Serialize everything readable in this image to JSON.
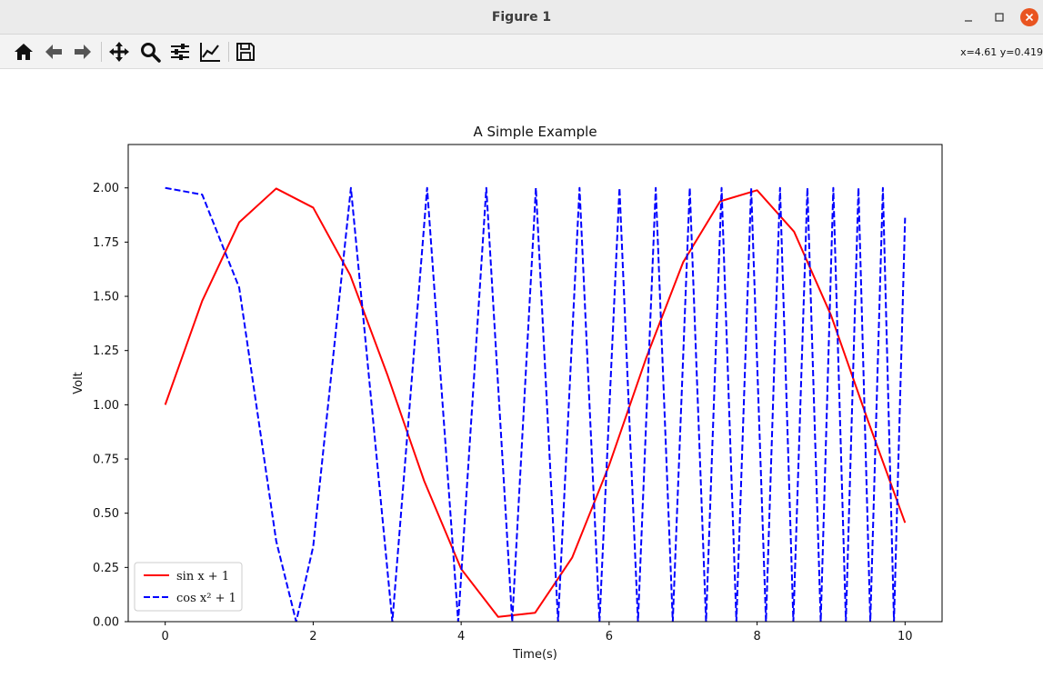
{
  "window": {
    "title": "Figure 1"
  },
  "toolbar": {
    "tools": [
      "home-icon",
      "back-arrow-icon",
      "forward-arrow-icon",
      "move-icon",
      "zoom-icon",
      "sliders-icon",
      "line-chart-icon",
      "save-icon"
    ],
    "coords": "x=4.61 y=0.419"
  },
  "chart_data": {
    "type": "line",
    "title": "A Simple Example",
    "xlabel": "Time(s)",
    "ylabel": "Volt",
    "xlim": [
      -0.5,
      10.5
    ],
    "ylim": [
      0.0,
      2.2
    ],
    "x_ticks": [
      "0",
      "2",
      "4",
      "6",
      "8",
      "10"
    ],
    "y_ticks": [
      "0.00",
      "0.25",
      "0.50",
      "0.75",
      "1.00",
      "1.25",
      "1.50",
      "1.75",
      "2.00"
    ],
    "grid": false,
    "legend_position": "lower-left",
    "series": [
      {
        "name": "sin x + 1",
        "color": "#ff0000",
        "style": "solid",
        "x": [
          0.0,
          0.5,
          1.0,
          1.5,
          2.0,
          2.5,
          3.0,
          3.5,
          4.0,
          4.5,
          5.0,
          5.5,
          6.0,
          6.5,
          7.0,
          7.5,
          8.0,
          8.5,
          9.0,
          9.5,
          10.0
        ],
        "y": [
          1.0,
          1.479,
          1.841,
          1.997,
          1.909,
          1.598,
          1.141,
          0.649,
          0.243,
          0.022,
          0.041,
          0.295,
          0.721,
          1.215,
          1.657,
          1.938,
          1.989,
          1.798,
          1.412,
          0.925,
          0.456
        ]
      },
      {
        "name": "cos x² + 1",
        "color": "#0000ff",
        "style": "dashed",
        "x": [
          0.0,
          0.5,
          1.0,
          1.5,
          1.77,
          2.0,
          2.51,
          3.07,
          3.54,
          3.96,
          4.34,
          4.69,
          5.01,
          5.31,
          5.6,
          5.87,
          6.14,
          6.39,
          6.63,
          6.86,
          7.09,
          7.31,
          7.52,
          7.72,
          7.92,
          8.12,
          8.31,
          8.49,
          8.68,
          8.86,
          9.03,
          9.2,
          9.37,
          9.53,
          9.7,
          9.85,
          10.0
        ],
        "y": [
          2.0,
          1.969,
          1.54,
          0.372,
          0.0,
          0.346,
          2.0,
          0.0,
          2.0,
          0.0,
          2.0,
          0.0,
          2.0,
          0.0,
          2.0,
          0.0,
          2.0,
          0.0,
          2.0,
          0.0,
          2.0,
          0.0,
          2.0,
          0.0,
          2.0,
          0.0,
          2.0,
          0.0,
          2.0,
          0.0,
          2.0,
          0.0,
          2.0,
          0.0,
          2.0,
          0.0,
          1.862
        ]
      }
    ]
  }
}
